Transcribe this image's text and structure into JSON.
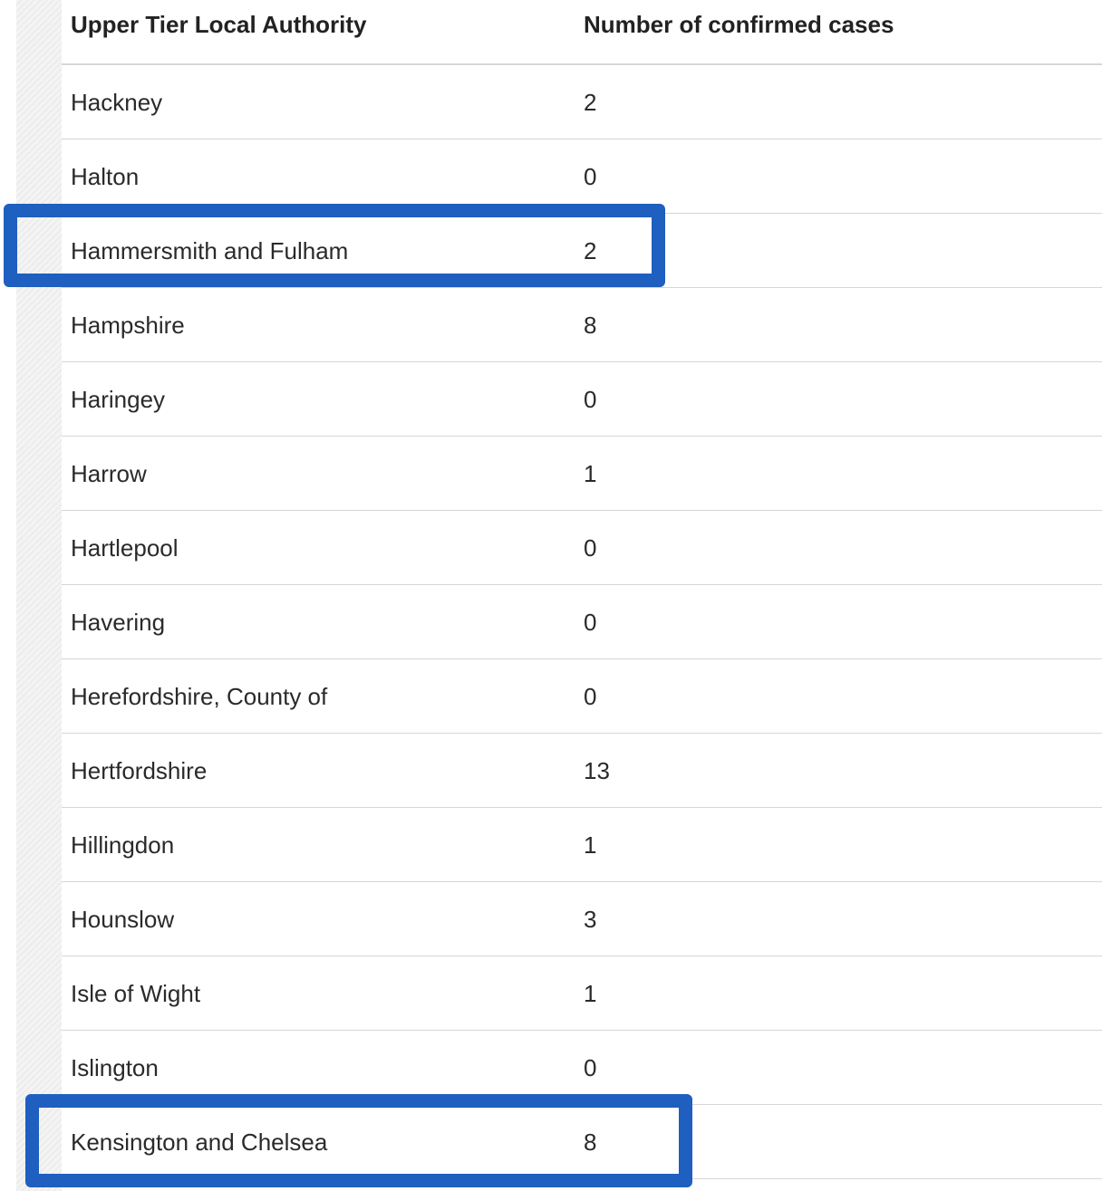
{
  "table": {
    "headers": {
      "authority": "Upper Tier Local Authority",
      "cases": "Number of confirmed cases"
    },
    "rows": [
      {
        "authority": "Hackney",
        "cases": "2"
      },
      {
        "authority": "Halton",
        "cases": "0"
      },
      {
        "authority": "Hammersmith and Fulham",
        "cases": "2"
      },
      {
        "authority": "Hampshire",
        "cases": "8"
      },
      {
        "authority": "Haringey",
        "cases": "0"
      },
      {
        "authority": "Harrow",
        "cases": "1"
      },
      {
        "authority": "Hartlepool",
        "cases": "0"
      },
      {
        "authority": "Havering",
        "cases": "0"
      },
      {
        "authority": "Herefordshire, County of",
        "cases": "0"
      },
      {
        "authority": "Hertfordshire",
        "cases": "13"
      },
      {
        "authority": "Hillingdon",
        "cases": "1"
      },
      {
        "authority": "Hounslow",
        "cases": "3"
      },
      {
        "authority": "Isle of Wight",
        "cases": "1"
      },
      {
        "authority": "Islington",
        "cases": "0"
      },
      {
        "authority": "Kensington and Chelsea",
        "cases": "8"
      }
    ]
  },
  "highlights": {
    "color": "#1f5fbf",
    "rows": [
      "Hammersmith and Fulham",
      "Kensington and Chelsea"
    ]
  }
}
